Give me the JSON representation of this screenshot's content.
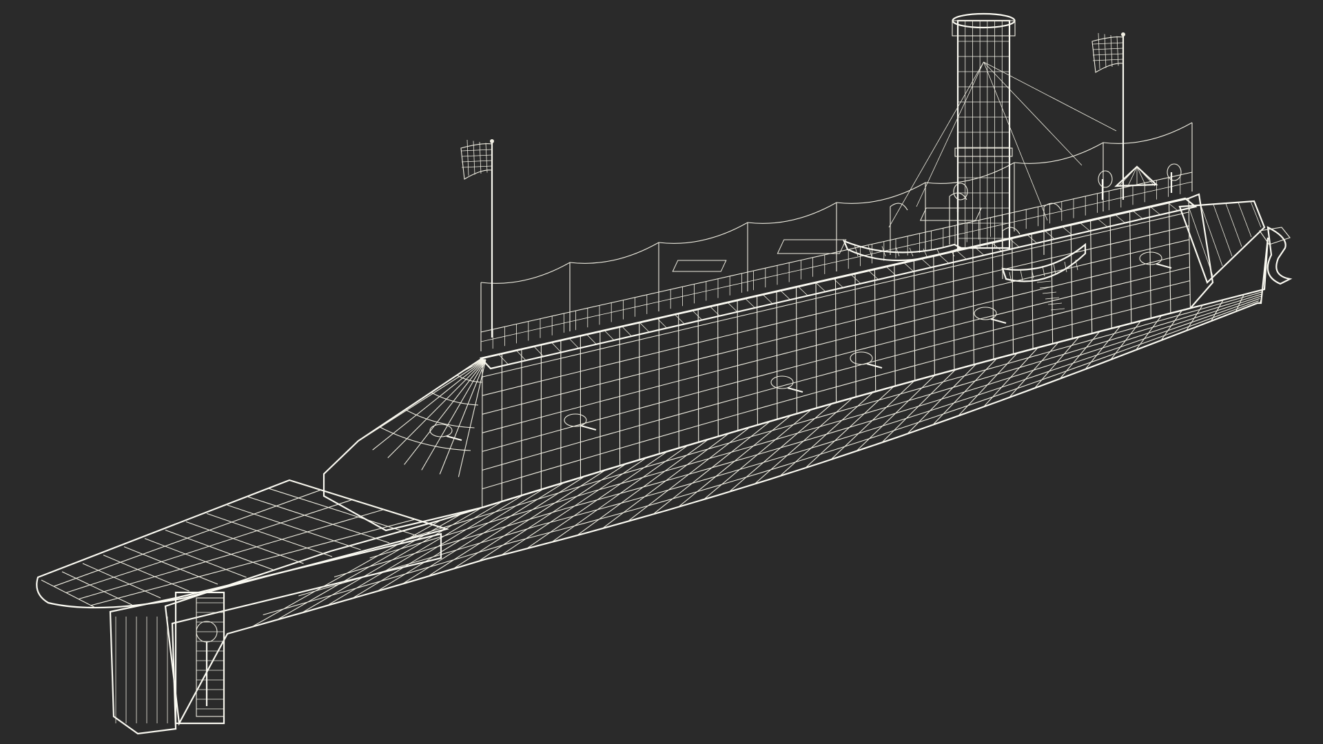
{
  "scene": {
    "background_color": "#2a2a2a",
    "mesh_fill_color": "#7c7c70",
    "mesh_shadow_color": "#5f5f55",
    "wire_color": "#f2f0e4",
    "subject": "ironclad-ship-wireframe"
  }
}
